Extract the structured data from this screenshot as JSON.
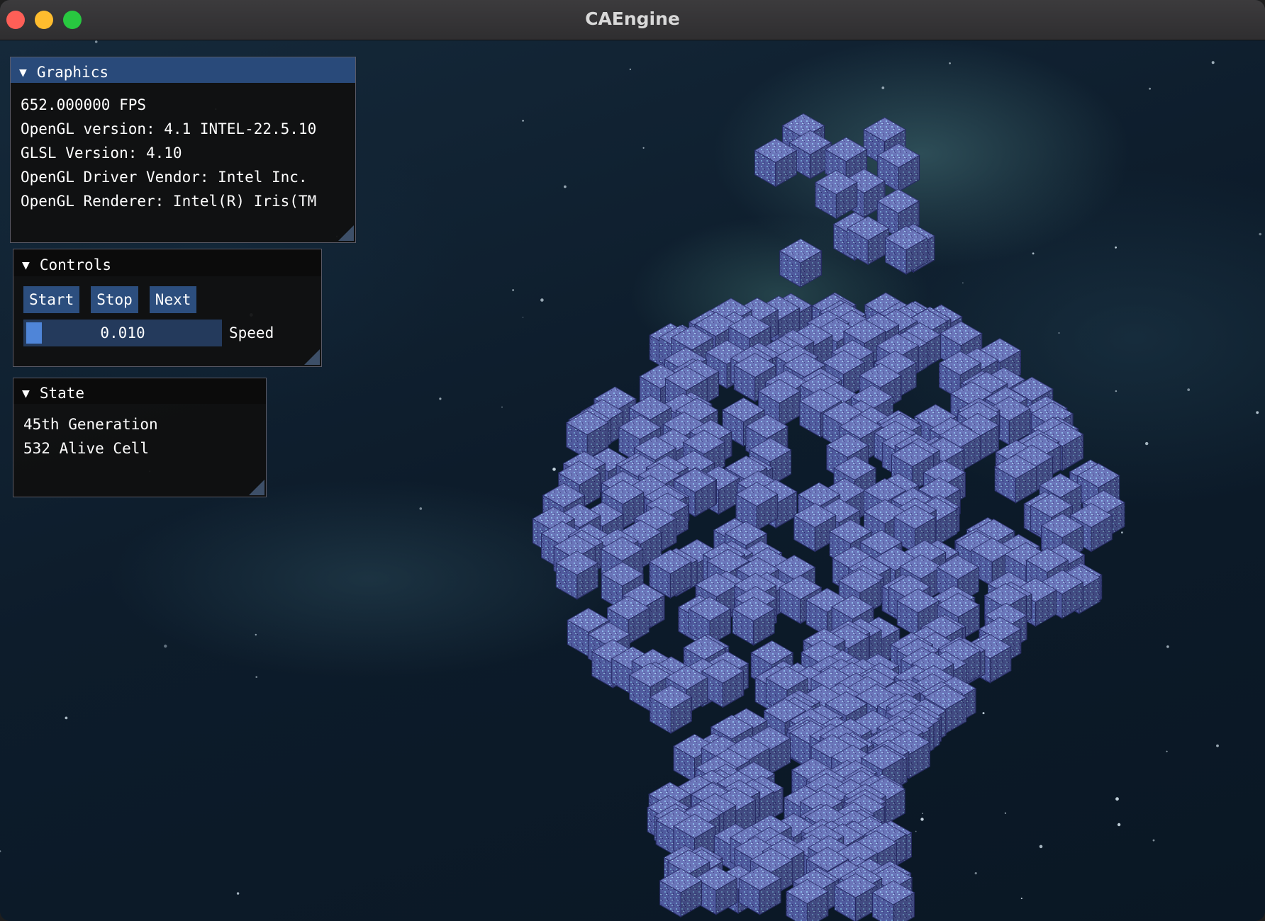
{
  "window": {
    "title": "CAEngine"
  },
  "colors": {
    "accent": "#294a7a",
    "button": "#2c4e7e",
    "cube": "#5b67b3",
    "background": "#0e1d2b"
  },
  "graphics_panel": {
    "title": "Graphics",
    "lines": [
      "652.000000 FPS",
      "OpenGL version: 4.1 INTEL-22.5.10",
      "GLSL Version: 4.10",
      "OpenGL Driver Vendor: Intel Inc.",
      "OpenGL Renderer: Intel(R) Iris(TM"
    ]
  },
  "controls_panel": {
    "title": "Controls",
    "start_label": "Start",
    "stop_label": "Stop",
    "next_label": "Next",
    "speed_value": "0.010",
    "speed_label": "Speed"
  },
  "state_panel": {
    "title": "State",
    "generation": "45th Generation",
    "alive": "532 Alive Cell"
  }
}
